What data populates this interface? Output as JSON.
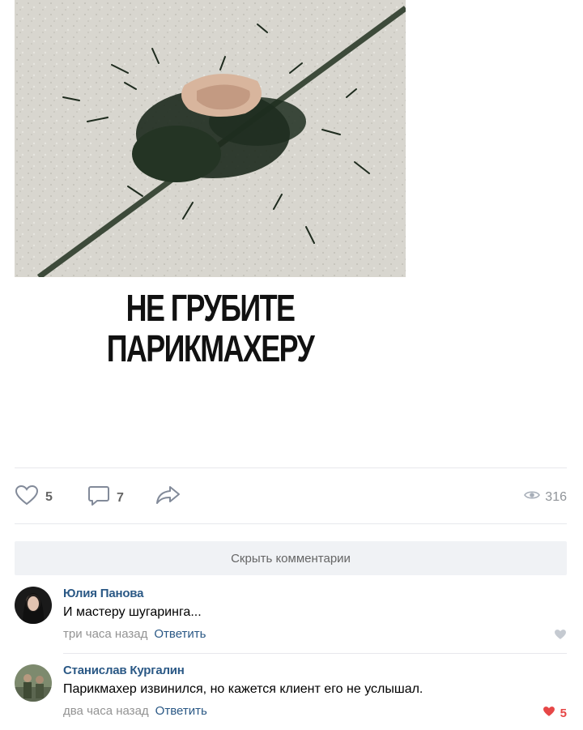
{
  "post": {
    "caption_line1": "НЕ ГРУБИТЕ",
    "caption_line2": "ПАРИКМАХЕРУ"
  },
  "actions": {
    "likes": "5",
    "comments": "7",
    "views": "316"
  },
  "hide_comments_label": "Скрыть комментарии",
  "comments": [
    {
      "author": "Юлия Панова",
      "text": "И мастеру шугаринга...",
      "time": "три часа назад",
      "reply": "Ответить",
      "likes": ""
    },
    {
      "author": "Станислав Кургалин",
      "text": "Парикмахер извинился, но кажется клиент его не услышал.",
      "time": "два часа назад",
      "reply": "Ответить",
      "likes": "5"
    }
  ],
  "colors": {
    "link": "#2a5885",
    "muted": "#939393",
    "like_active": "#e64646",
    "hide_bar_bg": "#f0f2f5"
  },
  "icons": [
    "heart-icon",
    "comment-icon",
    "share-icon",
    "eye-icon"
  ]
}
